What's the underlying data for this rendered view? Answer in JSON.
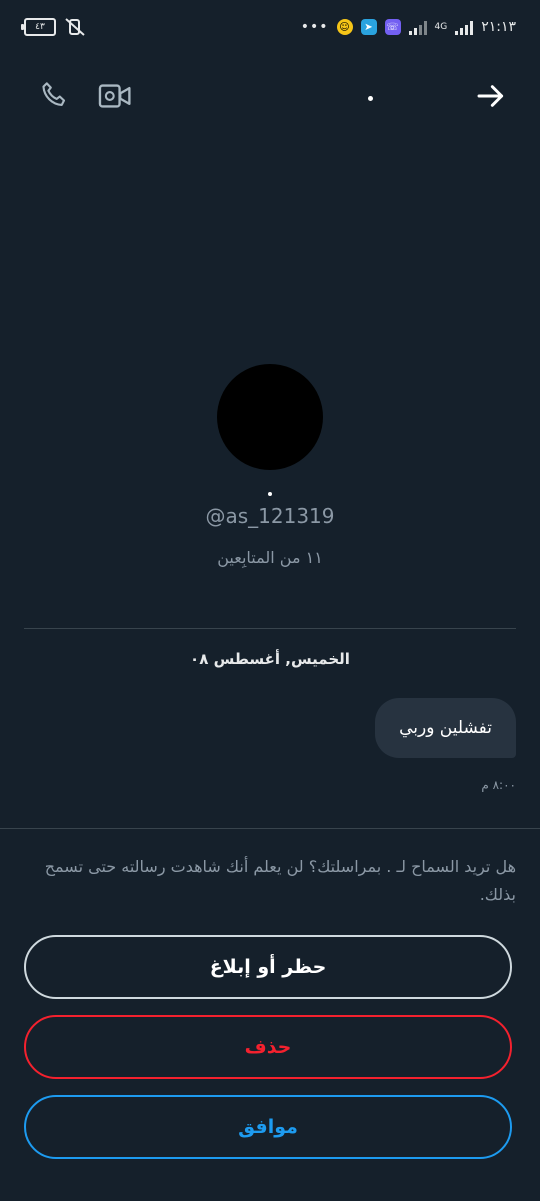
{
  "status_bar": {
    "time": "٢١:١٣",
    "network": "4G",
    "battery": "٤٣"
  },
  "header": {
    "title": "."
  },
  "profile": {
    "name": ".",
    "handle": "@as_121319",
    "followers": "١١ من المتابِعين"
  },
  "conversation": {
    "date": "الخميس, أغسطس ٠٨",
    "messages": [
      {
        "text": "تفشلين وربي",
        "time": "٨:٠٠ م"
      }
    ]
  },
  "request": {
    "notice": "هل تريد السماح لـ . بمراسلتك؟ لن يعلم أنك شاهدت رسالته حتى تسمح بذلك.",
    "block_label": "حظر أو إبلاغ",
    "delete_label": "حذف",
    "accept_label": "موافق"
  },
  "colors": {
    "background": "#15202b",
    "accent": "#1d9bf0",
    "danger": "#f4212e"
  },
  "icons": [
    "phone-icon",
    "video-call-icon",
    "back-arrow-icon"
  ]
}
